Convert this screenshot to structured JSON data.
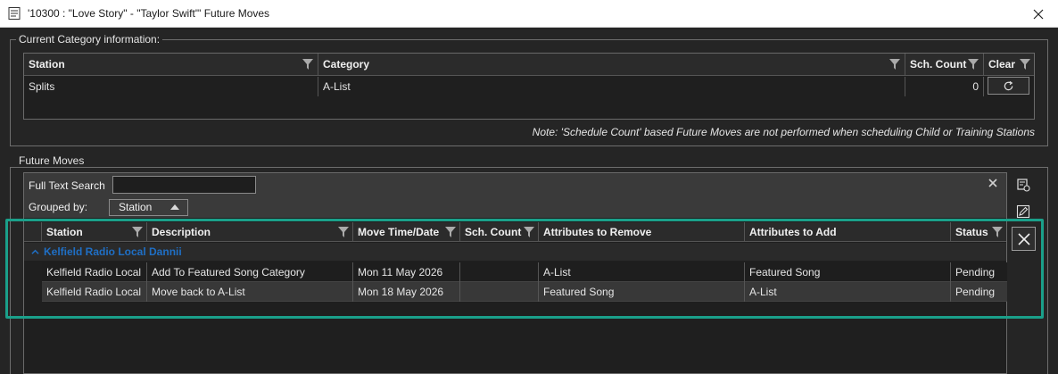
{
  "window": {
    "title": "'10300 : \"Love Story\" - \"Taylor Swift\"' Future Moves",
    "app_icon": "document-icon",
    "close_icon": "close-icon"
  },
  "current_category": {
    "legend": "Current Category information:",
    "columns": [
      "Station",
      "Category",
      "Sch. Count",
      "Clear"
    ],
    "row": {
      "station": "Splits",
      "category": "A-List",
      "sch_count": "0"
    },
    "clear_icon": "refresh-icon",
    "note": "Note: 'Schedule Count' based Future Moves are not performed when scheduling Child or Training Stations"
  },
  "future_moves": {
    "legend": "Future Moves",
    "search_label": "Full Text Search",
    "search_value": "",
    "grouped_by_label": "Grouped by:",
    "grouped_by_value": "Station",
    "columns": [
      "Station",
      "Description",
      "Move Time/Date",
      "Sch. Count",
      "Attributes to Remove",
      "Attributes to Add",
      "Status"
    ],
    "group_label": "Kelfield Radio Local Dannii",
    "rows": [
      {
        "station": "Kelfield Radio Local",
        "description": "Add To Featured Song Category",
        "move_time": "Mon 11 May 2026",
        "sch_count": "",
        "remove": "A-List",
        "add": "Featured Song",
        "status": "Pending"
      },
      {
        "station": "Kelfield Radio Local",
        "description": "Move back to A-List",
        "move_time": "Mon 18 May 2026",
        "sch_count": "",
        "remove": "Featured Song",
        "add": "A-List",
        "status": "Pending"
      }
    ]
  },
  "side_buttons": [
    "add-record-icon",
    "edit-icon",
    "delete-icon"
  ],
  "colors": {
    "highlight": "#1aa08a",
    "group_text": "#1f6fc5",
    "background": "#252525"
  }
}
